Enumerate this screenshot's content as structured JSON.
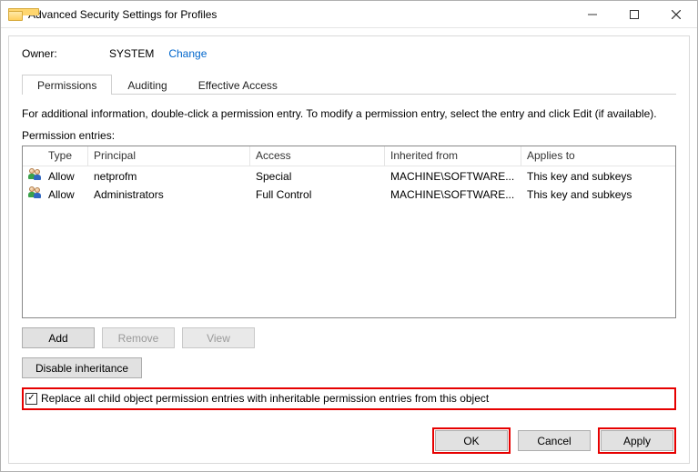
{
  "window": {
    "title": "Advanced Security Settings for Profiles"
  },
  "owner": {
    "label": "Owner:",
    "value": "SYSTEM",
    "change": "Change"
  },
  "tabs": [
    {
      "label": "Permissions",
      "active": true
    },
    {
      "label": "Auditing",
      "active": false
    },
    {
      "label": "Effective Access",
      "active": false
    }
  ],
  "infoText": "For additional information, double-click a permission entry. To modify a permission entry, select the entry and click Edit (if available).",
  "entriesLabel": "Permission entries:",
  "columns": {
    "type": "Type",
    "principal": "Principal",
    "access": "Access",
    "inherited": "Inherited from",
    "applies": "Applies to"
  },
  "entries": [
    {
      "type": "Allow",
      "principal": "netprofm",
      "access": "Special",
      "inherited": "MACHINE\\SOFTWARE...",
      "applies": "This key and subkeys"
    },
    {
      "type": "Allow",
      "principal": "Administrators",
      "access": "Full Control",
      "inherited": "MACHINE\\SOFTWARE...",
      "applies": "This key and subkeys"
    }
  ],
  "buttons": {
    "add": "Add",
    "remove": "Remove",
    "view": "View",
    "disableInheritance": "Disable inheritance",
    "ok": "OK",
    "cancel": "Cancel",
    "apply": "Apply"
  },
  "replace": {
    "checked": true,
    "label": "Replace all child object permission entries with inheritable permission entries from this object"
  }
}
